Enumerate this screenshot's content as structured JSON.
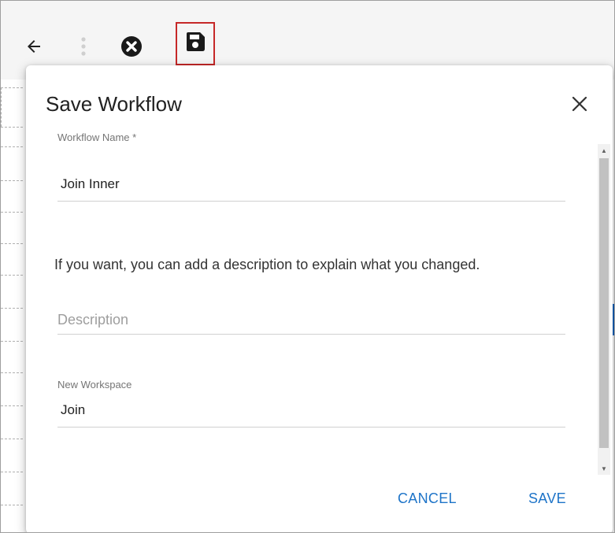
{
  "toolbar": {
    "back_icon": "arrow-left-icon",
    "more_icon": "vertical-dots-icon",
    "close_icon": "close-circle-icon",
    "save_icon": "floppy-disk-icon",
    "highlight_color": "#c62828"
  },
  "dialog": {
    "title": "Save Workflow",
    "close_icon": "close-icon",
    "workflow_name": {
      "label": "Workflow Name *",
      "value": "Join Inner"
    },
    "description_hint": "If you want, you can add a description to explain what you changed.",
    "description": {
      "placeholder": "Description",
      "value": ""
    },
    "workspace": {
      "label": "New Workspace",
      "value": "Join"
    },
    "cancel_label": "CANCEL",
    "save_label": "SAVE",
    "accent_color": "#1e74c8"
  }
}
